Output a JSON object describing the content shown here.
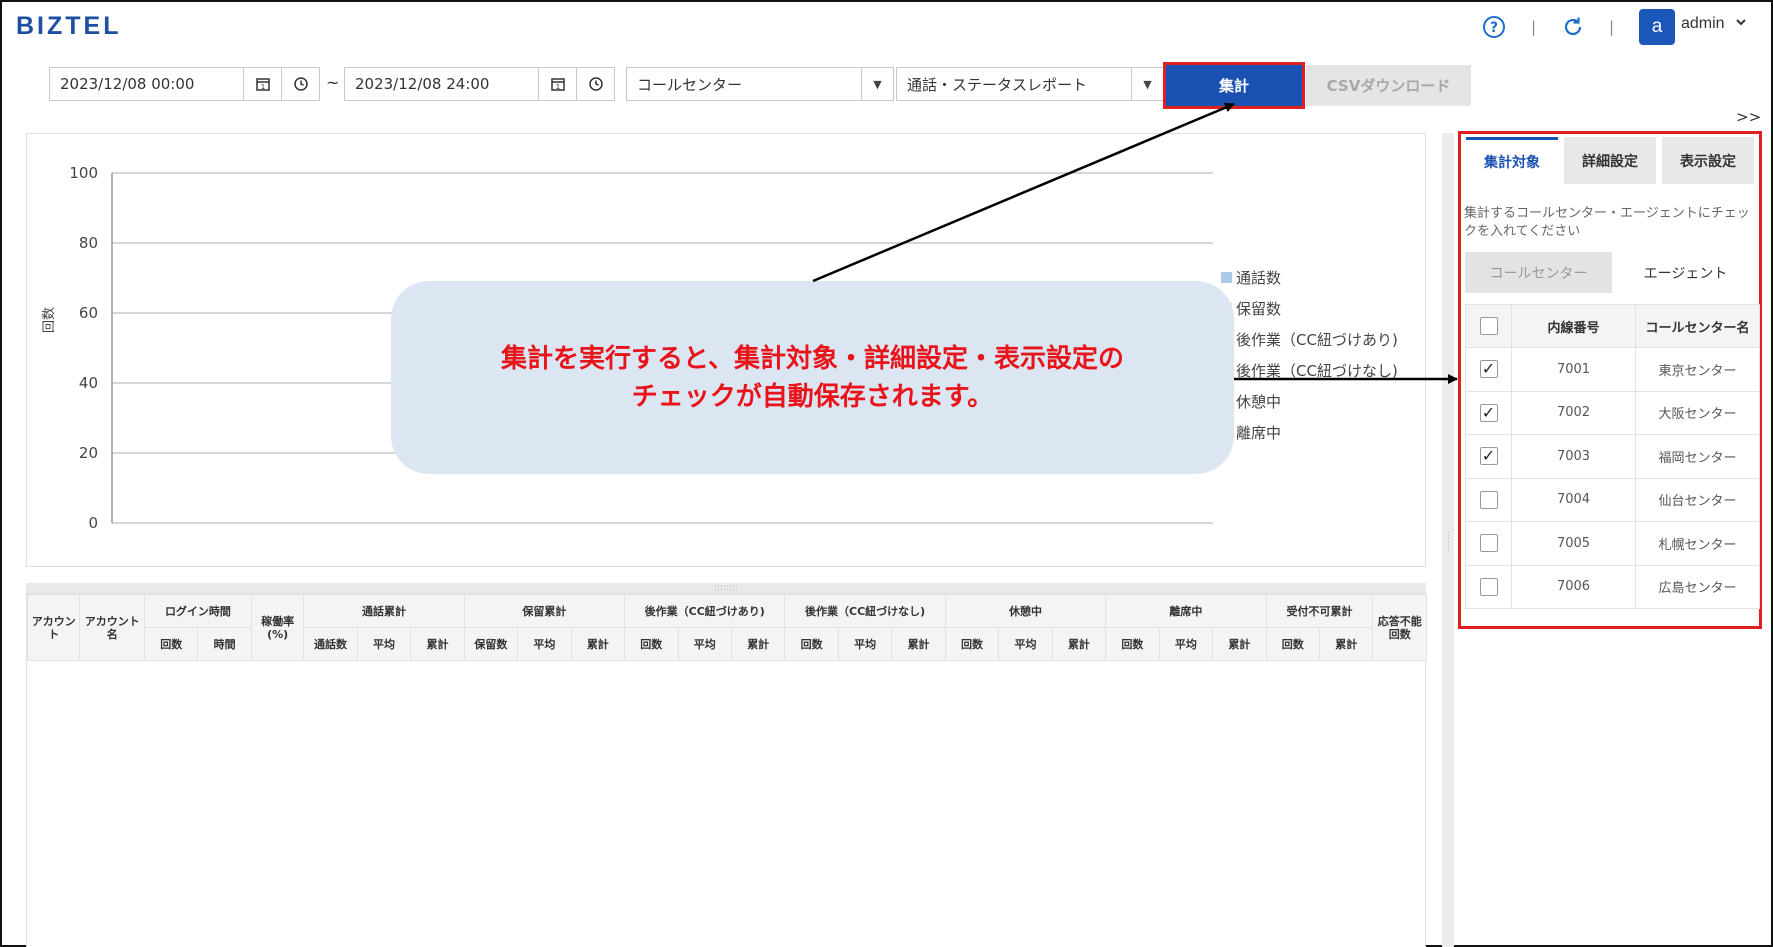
{
  "header": {
    "logo": "BIZTEL",
    "help_icon": "question-circle-icon",
    "refresh_icon": "refresh-icon",
    "separator": "|",
    "avatar_letter": "a",
    "user_name": "admin",
    "user_caret": "⌄"
  },
  "toolbar": {
    "start_value": "2023/12/08 00:00",
    "end_value": "2023/12/08 24:00",
    "range_separator": "~",
    "callcenter_select": "コールセンター",
    "report_select": "通話・ステータスレポート",
    "run_button": "集計",
    "csv_button": "CSVダウンロード",
    "expand_label": ">>"
  },
  "chart_data": {
    "type": "bar",
    "title": "",
    "xlabel": "",
    "ylabel": "回数",
    "ylim": [
      0,
      100
    ],
    "yticks": [
      "100",
      "80",
      "60",
      "40",
      "20",
      "0"
    ],
    "grid": true,
    "legend_position": "right",
    "categories": [],
    "series": [
      {
        "name": "通話数",
        "color": "#a9cbe9",
        "values": []
      },
      {
        "name": "保留数",
        "color": "#f5d48a",
        "values": []
      },
      {
        "name": "後作業（CC紐づけあり)",
        "color": "#cfcfcf",
        "values": []
      },
      {
        "name": "後作業（CC紐づけなし)",
        "color": "#cfcfcf",
        "values": []
      },
      {
        "name": "休憩中",
        "color": "#cfcfcf",
        "values": []
      },
      {
        "name": "離席中",
        "color": "#cfcfcf",
        "values": []
      }
    ]
  },
  "callout": {
    "line1": "集計を実行すると、集計対象・詳細設定・表示設定の",
    "line2": "チェックが自動保存されます。"
  },
  "table": {
    "groups": {
      "account": "アカウント",
      "account_name": "アカウント名",
      "login": "ログイン時間",
      "rate": "稼働率(%)",
      "call": "通話累計",
      "hold": "保留累計",
      "acw_linked": "後作業（CC紐づけあり)",
      "acw_unlinked": "後作業（CC紐づけなし)",
      "break": "休憩中",
      "away": "離席中",
      "reject": "受付不可累計",
      "noanswer": "応答不能回数"
    },
    "sub": {
      "count": "回数",
      "time": "時間",
      "avg": "平均",
      "total": "累計",
      "call_count": "通話数",
      "hold_count": "保留数"
    },
    "grip": "::::::::"
  },
  "side_panel": {
    "tabs": [
      "集計対象",
      "詳細設定",
      "表示設定"
    ],
    "description": "集計するコールセンター・エージェントにチェックを入れてください",
    "subtabs": [
      "コールセンター",
      "エージェント"
    ],
    "columns": [
      "内線番号",
      "コールセンター名"
    ],
    "rows": [
      {
        "ext": "7001",
        "name": "東京センター",
        "checked": true
      },
      {
        "ext": "7002",
        "name": "大阪センター",
        "checked": true
      },
      {
        "ext": "7003",
        "name": "福岡センター",
        "checked": true
      },
      {
        "ext": "7004",
        "name": "仙台センター",
        "checked": false
      },
      {
        "ext": "7005",
        "name": "札幌センター",
        "checked": false
      },
      {
        "ext": "7006",
        "name": "広島センター",
        "checked": false
      }
    ]
  }
}
